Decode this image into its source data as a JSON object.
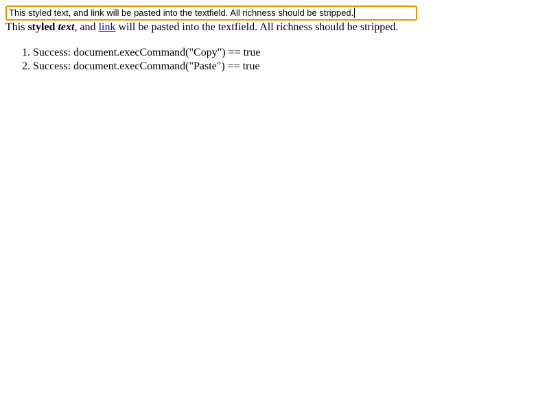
{
  "textfield": {
    "value": "This styled text, and link will be pasted into the textfield. All richness should be stripped."
  },
  "source": {
    "part1": "This ",
    "bold": "styled",
    "space": " ",
    "bold_italic": "text",
    "part2": ", and ",
    "link": "link",
    "part3": " will be pasted into the textfield. All richness should be stripped."
  },
  "results": [
    {
      "text": "Success: document.execCommand(\"Copy\") == true"
    },
    {
      "text": "Success: document.execCommand(\"Paste\") == true"
    }
  ],
  "colors": {
    "focus_ring": "#e59700",
    "link": "#0000ee",
    "text": "#000000"
  }
}
